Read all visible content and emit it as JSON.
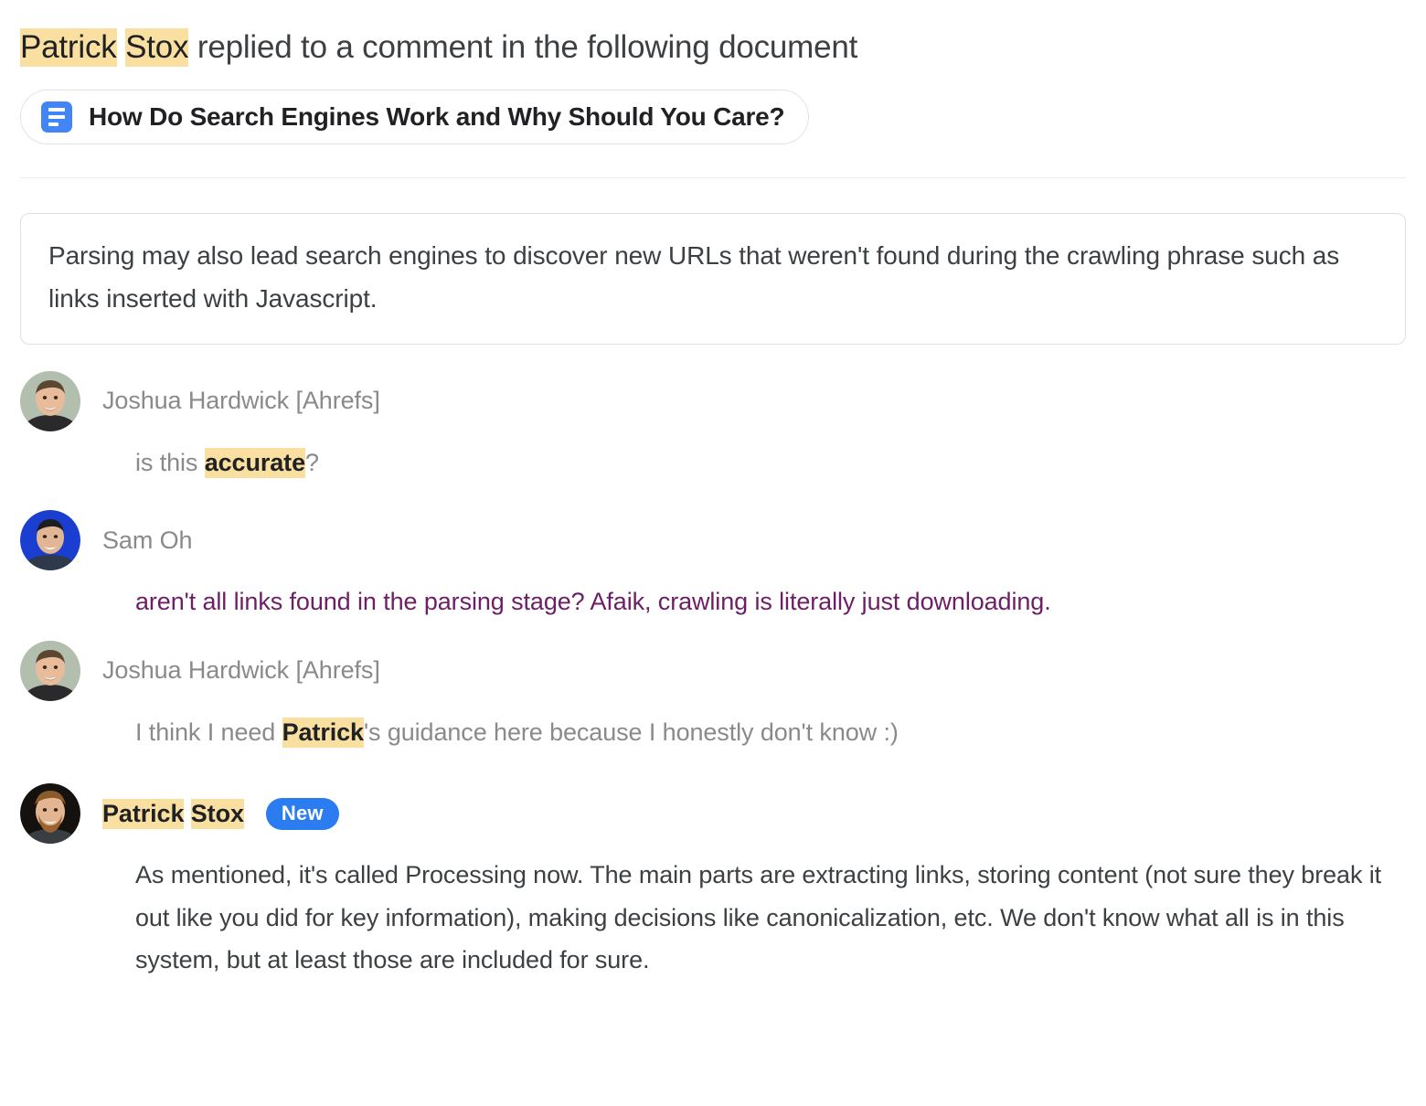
{
  "colors": {
    "highlight": "#fae0a0",
    "badge_blue": "#2b7cf0",
    "doc_icon_blue": "#4285f4",
    "purple_text": "#6e1e66",
    "gray_text": "#8a8a8a",
    "dark_text": "#3c4043"
  },
  "header": {
    "actor_first": "Patrick",
    "actor_last": "Stox",
    "action_text": " replied to a comment in the following document",
    "doc_icon_name": "google-docs-icon",
    "doc_title": "How Do Search Engines Work and Why Should You Care?"
  },
  "quote": {
    "text": "Parsing may also lead search engines to discover new URLs that weren't found during the crawling phrase such as links inserted with Javascript."
  },
  "thread": [
    {
      "author": "Joshua Hardwick [Ahrefs]",
      "avatar_name": "avatar-joshua-hardwick",
      "body_pre": "is this ",
      "body_highlight": "accurate",
      "body_post": "?"
    },
    {
      "author": "Sam Oh",
      "avatar_name": "avatar-sam-oh",
      "body": "aren't all links found in the parsing stage? Afaik, crawling is literally just downloading."
    },
    {
      "author": "Joshua Hardwick [Ahrefs]",
      "avatar_name": "avatar-joshua-hardwick",
      "body_pre": "I think I need ",
      "body_highlight": "Patrick",
      "body_post": "'s guidance here because I honestly don't know :)"
    },
    {
      "author_first": "Patrick",
      "author_last": "Stox",
      "badge": "New",
      "avatar_name": "avatar-patrick-stox",
      "body": "As mentioned, it's called Processing now. The main parts are extracting links, storing content (not sure they break it out like you did for key information), making decisions like canonicalization, etc. We don't know what all is in this system, but at least those are included for sure."
    }
  ]
}
